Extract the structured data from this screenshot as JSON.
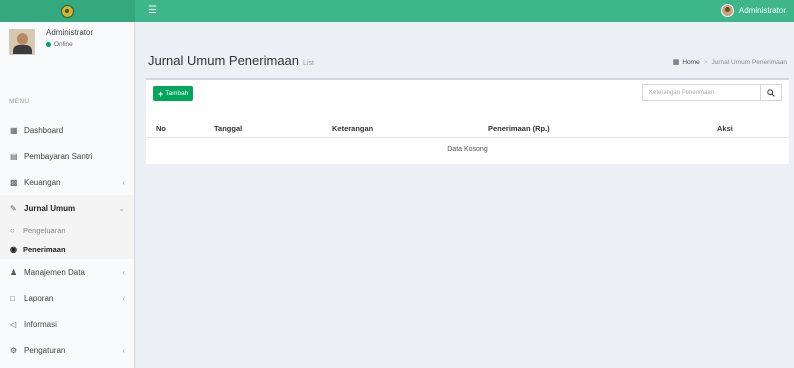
{
  "header": {
    "user_name": "Administrator"
  },
  "sidebar": {
    "user": {
      "name": "Administrator",
      "status": "Online"
    },
    "menu_header": "MENU",
    "items": [
      {
        "label": "Dashboard",
        "icon": "dashboard-icon"
      },
      {
        "label": "Pembayaran Santri",
        "icon": "credit-card-icon"
      },
      {
        "label": "Keuangan",
        "icon": "money-icon"
      },
      {
        "label": "Jurnal Umum",
        "icon": "edit-icon"
      },
      {
        "label": "Manajemen Data",
        "icon": "users-icon"
      },
      {
        "label": "Laporan",
        "icon": "file-icon"
      },
      {
        "label": "Informasi",
        "icon": "bullhorn-icon"
      },
      {
        "label": "Pengaturan",
        "icon": "gear-icon"
      }
    ],
    "submenu": [
      {
        "label": "Pengeluaran"
      },
      {
        "label": "Penerimaan"
      }
    ]
  },
  "content": {
    "title": "Jurnal Umum Penerimaan",
    "subtitle": "List",
    "breadcrumb": {
      "home": "Home",
      "current": "Jurnal Umum Penerimaan"
    },
    "add_button": "Tambah",
    "search_placeholder": "Keterangan Penerimaan",
    "columns": [
      "No",
      "Tanggal",
      "Keterangan",
      "Penerimaan (Rp.)",
      "Aksi"
    ],
    "empty_text": "Data Kosong"
  },
  "colors": {
    "topbar": "#3cb68a",
    "success": "#00a65a",
    "sidebar_bg": "#f9fafc",
    "content_bg": "#ecf0f5"
  }
}
